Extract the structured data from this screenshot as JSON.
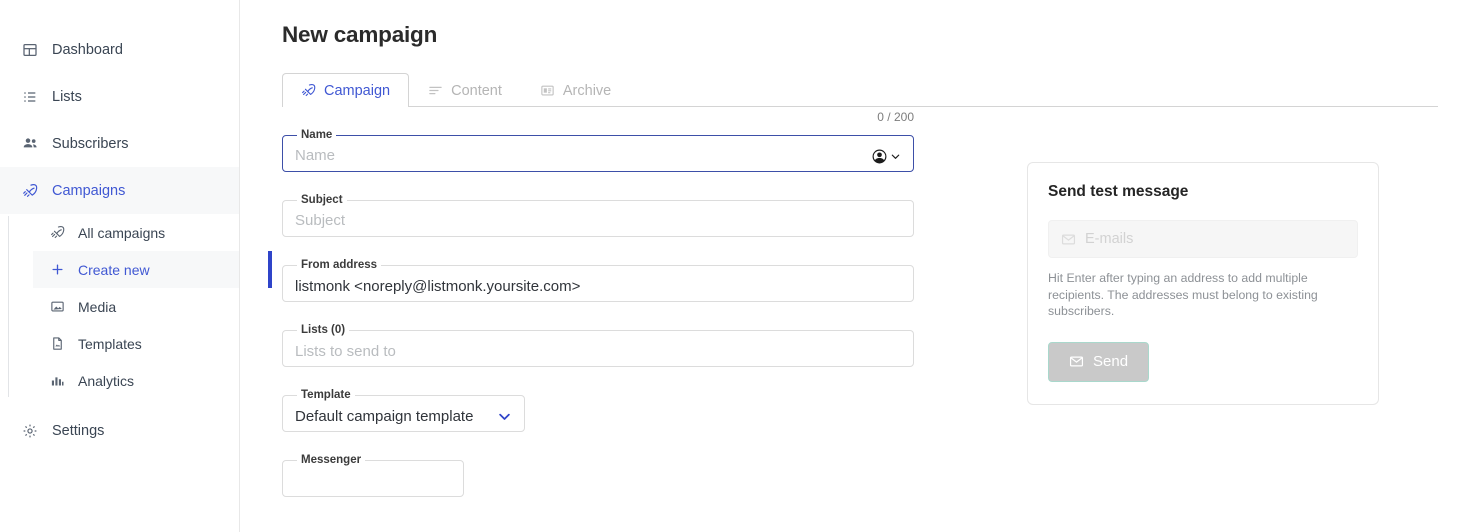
{
  "sidebar": {
    "items": [
      {
        "label": "Dashboard",
        "icon": "dashboard-icon"
      },
      {
        "label": "Lists",
        "icon": "list-icon"
      },
      {
        "label": "Subscribers",
        "icon": "people-icon"
      },
      {
        "label": "Campaigns",
        "icon": "rocket-icon"
      }
    ],
    "subitems": [
      {
        "label": "All campaigns",
        "icon": "rocket-icon"
      },
      {
        "label": "Create new",
        "icon": "plus-icon"
      },
      {
        "label": "Media",
        "icon": "image-icon"
      },
      {
        "label": "Templates",
        "icon": "file-icon"
      },
      {
        "label": "Analytics",
        "icon": "bar-chart-icon"
      }
    ],
    "settings": {
      "label": "Settings",
      "icon": "gear-icon"
    },
    "active_item": "Campaigns",
    "selected_subitem": "Create new",
    "accent_color": "#4058d3",
    "indicator_color": "#2f44c9"
  },
  "header": {
    "title": "New campaign"
  },
  "tabs": [
    {
      "label": "Campaign",
      "icon": "rocket-icon",
      "active": true
    },
    {
      "label": "Content",
      "icon": "text-lines-icon",
      "active": false
    },
    {
      "label": "Archive",
      "icon": "article-card-icon",
      "active": false
    }
  ],
  "form": {
    "counter": "0 / 200",
    "name": {
      "legend": "Name",
      "value": "",
      "placeholder": "Name",
      "adornment_icon": "account-circle-icon",
      "adornment_chevron": "chevron-down-icon",
      "focused": true
    },
    "subject": {
      "legend": "Subject",
      "value": "",
      "placeholder": "Subject"
    },
    "from_address": {
      "legend": "From address",
      "value": "listmonk <noreply@listmonk.yoursite.com>",
      "placeholder": ""
    },
    "lists": {
      "legend": "Lists (0)",
      "value": "",
      "placeholder": "Lists to send to"
    },
    "template": {
      "legend": "Template",
      "value": "Default campaign template",
      "chevron_icon": "chevron-down-icon"
    },
    "messenger": {
      "legend": "Messenger"
    }
  },
  "test_panel": {
    "title": "Send test message",
    "emails_placeholder": "E-mails",
    "emails_icon": "envelope-icon",
    "hint": "Hit Enter after typing an address to add multiple recipients. The addresses must belong to existing subscribers.",
    "send_label": "Send",
    "send_icon": "envelope-icon",
    "send_border_color": "#a9d8cc",
    "send_fill_color": "#c9c9c9"
  }
}
